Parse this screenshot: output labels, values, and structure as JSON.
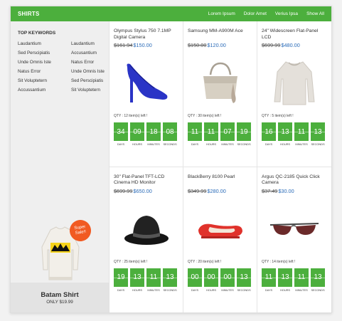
{
  "header": {
    "title": "SHIRTS",
    "nav": [
      "Lorem Ipsum",
      "Dolor Amet",
      "Verius Ipsa",
      "Show All"
    ]
  },
  "sidebar": {
    "title": "TOP KEYWORDS",
    "keywords": [
      "Laudantium",
      "Laudantium",
      "Sed Perscipiatis",
      "Accusantium",
      "Unde Omnis Iste",
      "Natus Error",
      "Natus Error",
      "Unde Omnis Iste",
      "Sit Voluptetern",
      "Sed Perscipiatis",
      "Accussantium",
      "Sit Voluptetern"
    ],
    "promo": {
      "badge_line1": "Super",
      "badge_line2": "Sale!!",
      "name": "Batam Shirt",
      "price": "ONLY $19.99"
    }
  },
  "timer_labels": [
    "DAYS",
    "HOURS",
    "MINUTES",
    "SECONDS"
  ],
  "products": [
    {
      "name": "Olympus Stylus 750 7.1MP Digital Camera",
      "old_price": "$161.94",
      "new_price": "$150.00",
      "qty": "QTY : 12 item(s) left !",
      "timer": [
        "34",
        "09",
        "18",
        "08"
      ],
      "image": "heel-shoe"
    },
    {
      "name": "Samsung MM-A900M Ace",
      "old_price": "$150.00",
      "new_price": "$120.00",
      "qty": "QTY : 30 item(s) left !",
      "timer": [
        "11",
        "11",
        "07",
        "19"
      ],
      "image": "handbag"
    },
    {
      "name": "24\" Widescreen Flat-Panel LCD",
      "old_price": "$699.99",
      "new_price": "$480.00",
      "qty": "QTY : 5 item(s) left !",
      "timer": [
        "16",
        "13",
        "11",
        "13"
      ],
      "image": "sweater"
    },
    {
      "name": "30\" Flat-Panel TFT-LCD Cinema HD Monitor",
      "old_price": "$699.99",
      "new_price": "$650.00",
      "qty": "QTY : 25 item(s) left !",
      "timer": [
        "19",
        "13",
        "11",
        "13"
      ],
      "image": "hat"
    },
    {
      "name": "BlackBerry 8100 Pearl",
      "old_price": "$349.99",
      "new_price": "$280.00",
      "qty": "QTY : 20 item(s) left !",
      "timer": [
        "00",
        "00",
        "00",
        "13"
      ],
      "image": "flat-shoe"
    },
    {
      "name": "Argus QC-2185 Quick Click Camera",
      "old_price": "$37.49",
      "new_price": "$30.00",
      "qty": "QTY : 14 item(s) left !",
      "timer": [
        "11",
        "13",
        "11",
        "13"
      ],
      "image": "sunglasses"
    }
  ]
}
